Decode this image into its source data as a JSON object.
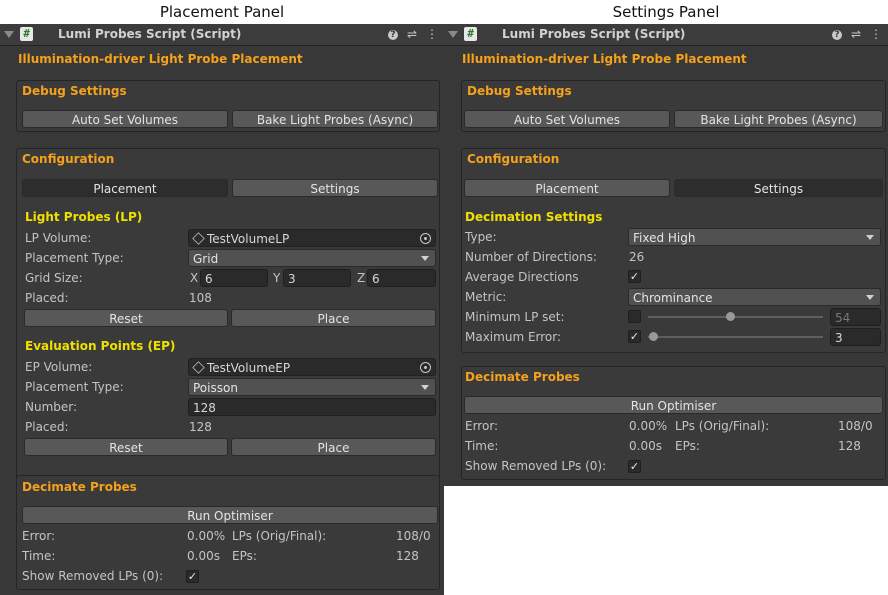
{
  "captions": {
    "left": "Placement Panel",
    "right": "Settings Panel"
  },
  "component": {
    "icon_glyph": "#",
    "title": "Lumi Probes Script (Script)",
    "main_title": "Illumination-driver Light Probe Placement",
    "icons": {
      "help": "?",
      "presets": "⇌",
      "menu": "⋮"
    }
  },
  "debug": {
    "title": "Debug Settings",
    "auto_set_volumes": "Auto Set Volumes",
    "bake": "Bake Light Probes (Async)"
  },
  "config": {
    "title": "Configuration",
    "tab_placement": "Placement",
    "tab_settings": "Settings"
  },
  "lp": {
    "title": "Light Probes (LP)",
    "volume_label": "LP Volume:",
    "volume_value": "TestVolumeLP",
    "placement_type_label": "Placement Type:",
    "placement_type_value": "Grid",
    "grid_size_label": "Grid Size:",
    "x_label": "X",
    "x_value": "6",
    "y_label": "Y",
    "y_value": "3",
    "z_label": "Z",
    "z_value": "6",
    "placed_label": "Placed:",
    "placed_value": "108",
    "reset": "Reset",
    "place": "Place"
  },
  "ep": {
    "title": "Evaluation Points (EP)",
    "volume_label": "EP Volume:",
    "volume_value": "TestVolumeEP",
    "placement_type_label": "Placement Type:",
    "placement_type_value": "Poisson",
    "number_label": "Number:",
    "number_value": "128",
    "placed_label": "Placed:",
    "placed_value": "128",
    "reset": "Reset",
    "place": "Place"
  },
  "decimation": {
    "title": "Decimation Settings",
    "type_label": "Type:",
    "type_value": "Fixed High",
    "directions_label": "Number of Directions:",
    "directions_value": "26",
    "average_label": "Average Directions",
    "average_checked": true,
    "metric_label": "Metric:",
    "metric_value": "Chrominance",
    "min_lp_label": "Minimum LP set:",
    "min_lp_checked": false,
    "min_lp_value": "54",
    "min_lp_fraction": 0.47,
    "max_error_label": "Maximum Error:",
    "max_error_checked": true,
    "max_error_value": "3",
    "max_error_fraction": 0.03
  },
  "decimate": {
    "title": "Decimate Probes",
    "run": "Run Optimiser",
    "error_label": "Error:",
    "error_value": "0.00%",
    "lps_label": "LPs (Orig/Final):",
    "lps_value": "108/0",
    "time_label": "Time:",
    "time_value": "0.00s",
    "eps_label": "EPs:",
    "eps_value": "128",
    "removed_label": "Show Removed LPs (0):",
    "removed_checked": true,
    "check_glyph": "✓"
  }
}
